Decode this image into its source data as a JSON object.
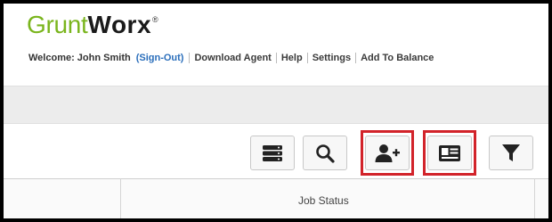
{
  "brand": {
    "part1": "Grunt",
    "part2": "Worx",
    "reg_mark": "®"
  },
  "nav": {
    "welcome": "Welcome: John Smith",
    "sign_out": "(Sign-Out)",
    "links": [
      "Download Agent",
      "Help",
      "Settings",
      "Add To Balance"
    ]
  },
  "toolbar": {
    "buttons": [
      {
        "icon": "list-icon",
        "highlighted": false
      },
      {
        "icon": "search-icon",
        "highlighted": false
      },
      {
        "icon": "add-user-icon",
        "highlighted": true
      },
      {
        "icon": "contact-card-icon",
        "highlighted": true
      },
      {
        "icon": "filter-icon",
        "highlighted": false
      }
    ]
  },
  "table": {
    "columns": [
      "",
      "Job Status"
    ]
  },
  "colors": {
    "brand_green": "#7ab51d",
    "link_blue": "#2a6ebb",
    "highlight_red": "#d2232a",
    "bar_gray": "#ececec"
  }
}
